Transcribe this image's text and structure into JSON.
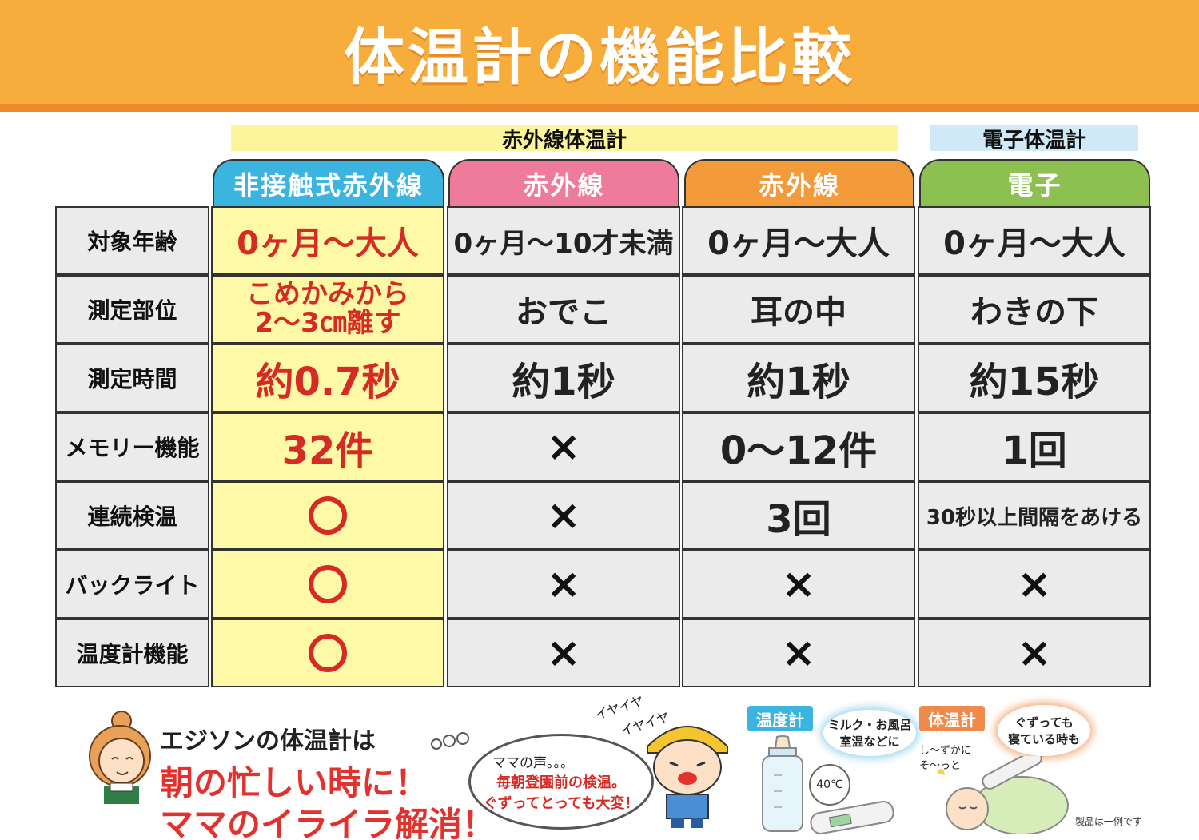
{
  "title": "体温計の機能比較",
  "groups": {
    "infrared": "赤外線体温計",
    "electronic": "電子体温計"
  },
  "columns": [
    {
      "label": "非接触式赤外線",
      "color": "#3cb4e0"
    },
    {
      "label": "赤外線",
      "color": "#ef7b9a"
    },
    {
      "label": "赤外線",
      "color": "#f39a3b"
    },
    {
      "label": "電子",
      "color": "#8cc152"
    }
  ],
  "rows": [
    {
      "label": "対象年齢",
      "values": [
        "0ヶ月〜大人",
        "0ヶ月〜10才未満",
        "0ヶ月〜大人",
        "0ヶ月〜大人"
      ]
    },
    {
      "label": "測定部位",
      "values": [
        "こめかみから\n2〜3㎝離す",
        "おでこ",
        "耳の中",
        "わきの下"
      ]
    },
    {
      "label": "測定時間",
      "values": [
        "約0.7秒",
        "約1秒",
        "約1秒",
        "約15秒"
      ]
    },
    {
      "label": "メモリー機能",
      "values": [
        "32件",
        "×",
        "0〜12件",
        "1回"
      ]
    },
    {
      "label": "連続検温",
      "values": [
        "○",
        "×",
        "3回",
        "30秒以上間隔をあける"
      ]
    },
    {
      "label": "バックライト",
      "values": [
        "○",
        "×",
        "×",
        "×"
      ]
    },
    {
      "label": "温度計機能",
      "values": [
        "○",
        "×",
        "×",
        "×"
      ]
    }
  ],
  "bottom": {
    "line1": "エジソンの体温計は",
    "line2": "朝の忙しい時に！",
    "line3": "ママのイライラ解消！",
    "bubble1": "ママの声。。。",
    "bubble2": "毎朝登園前の検温。",
    "bubble3": "ぐずってとっても大変！",
    "kid1": "イヤイヤ",
    "kid2": "イヤイヤ",
    "tag_temp": "温度計",
    "tag_body": "体温計",
    "glow1a": "ミルク・お風呂",
    "glow1b": "室温などに",
    "glow2a": "ぐずっても",
    "glow2b": "寝ている時も",
    "sleepy1": "し〜ずかに",
    "sleepy2": "そ〜っと",
    "reading": "40℃",
    "disclaimer": "製品は一例です"
  },
  "colors": {
    "banner": "#f7ad3c",
    "highlight_text": "#d62b25",
    "highlight_bg": "#fdf9a6"
  }
}
